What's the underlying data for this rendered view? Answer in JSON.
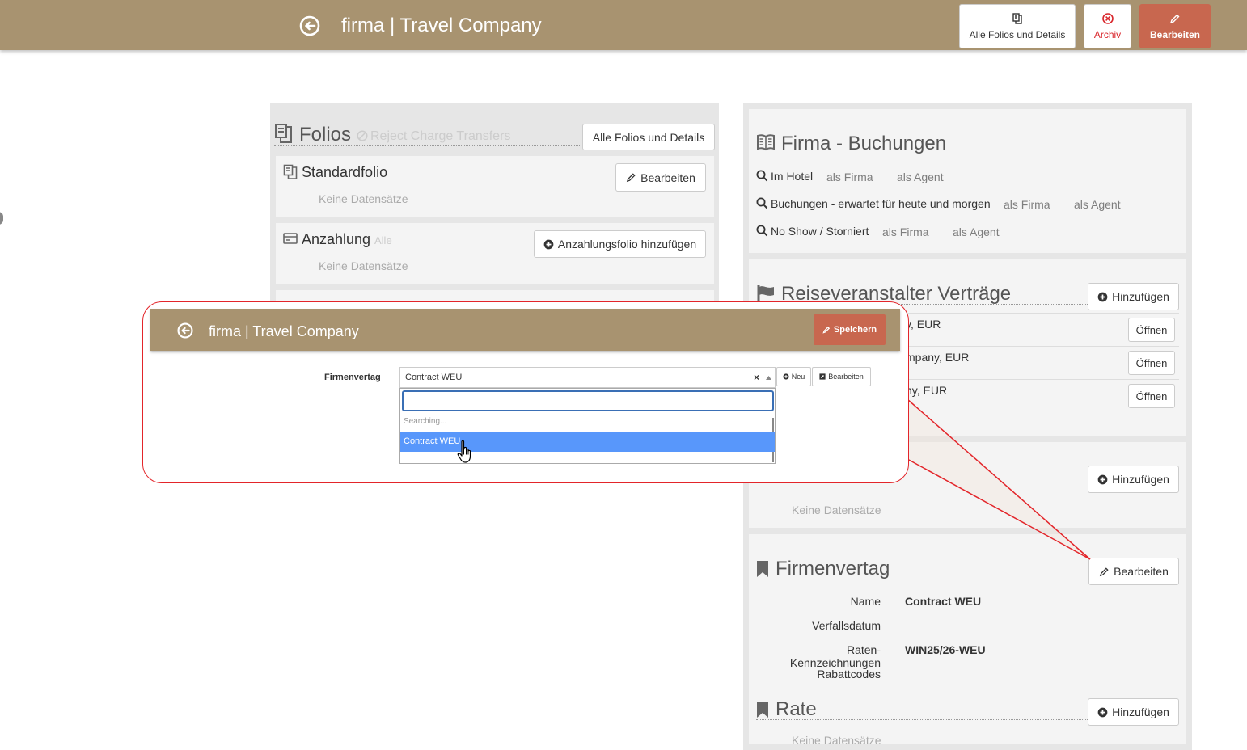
{
  "header": {
    "title": "firma | Travel Company",
    "btn_folios": "Alle Folios und Details",
    "btn_archiv": "Archiv",
    "btn_edit": "Bearbeiten"
  },
  "folios": {
    "title": "Folios",
    "reject": "Reject Charge Transfers",
    "btn_all": "Alle Folios und Details",
    "standard": {
      "title": "Standardfolio",
      "edit": "Bearbeiten",
      "empty": "Keine Datensätze"
    },
    "deposit": {
      "title": "Anzahlung",
      "tag": "Alle",
      "add": "Anzahlungsfolio hinzufügen",
      "empty": "Keine Datensätze"
    }
  },
  "bookings": {
    "title": "Firma - Buchungen",
    "rows": [
      {
        "label": "Im Hotel",
        "a": "als Firma",
        "b": "als Agent"
      },
      {
        "label": "Buchungen - erwartet für heute und morgen",
        "a": "als Firma",
        "b": "als Agent"
      },
      {
        "label": "No Show / Storniert",
        "a": "als Firma",
        "b": "als Agent"
      }
    ]
  },
  "contracts": {
    "title": "Reiseveranstalter Verträge",
    "add": "Hinzufügen",
    "rows": [
      {
        "text": "y, EUR",
        "open": "Öffnen"
      },
      {
        "text": "mpany, EUR",
        "open": "Öffnen"
      },
      {
        "text": "ny, EUR",
        "open": "Öffnen"
      }
    ]
  },
  "section4": {
    "add": "Hinzufügen",
    "empty": "Keine Datensätze"
  },
  "company_contract": {
    "title": "Firmenvertag",
    "edit": "Bearbeiten",
    "fields": [
      {
        "label": "Name",
        "value": "Contract WEU"
      },
      {
        "label": "Verfallsdatum",
        "value": ""
      },
      {
        "label": "Raten-Kennzeichnungen",
        "value": "WIN25/26-WEU"
      },
      {
        "label": "Rabattcodes",
        "value": ""
      }
    ]
  },
  "rate": {
    "title": "Rate",
    "add": "Hinzufügen",
    "empty": "Keine Datensätze"
  },
  "zoom": {
    "title": "firma | Travel Company",
    "save": "Speichern",
    "field_label": "Firmenvertag",
    "select_value": "Contract WEU",
    "clear": "×",
    "btn_new": "Neu",
    "btn_edit": "Bearbeiten",
    "searching": "Searching...",
    "option": "Contract WEU"
  },
  "colors": {
    "header": "#a89370",
    "accent": "#c8674f",
    "highlight": "#5897fb",
    "callout": "#e3252a"
  }
}
